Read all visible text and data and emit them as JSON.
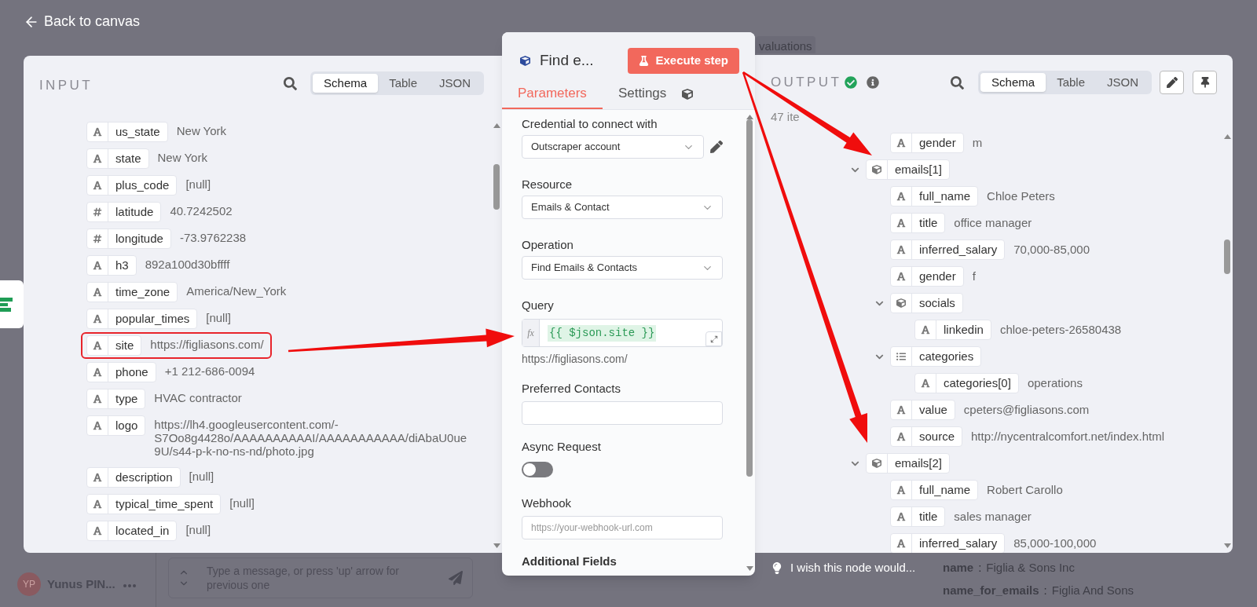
{
  "background": {
    "back_link": "Back to canvas",
    "tab_label": "valuations",
    "user": {
      "initials": "YP",
      "name": "Yunus PIN..."
    },
    "chat": {
      "placeholder": "Type a message, or press 'up' arrow for previous one"
    },
    "details": [
      {
        "key": "name",
        "separator": ":",
        "value": "Figlia & Sons Inc"
      },
      {
        "key": "name_for_emails",
        "separator": ":",
        "value": "Figlia And Sons"
      }
    ]
  },
  "input": {
    "title": "INPUT",
    "views": [
      {
        "label": "Schema",
        "selected": true
      },
      {
        "label": "Table",
        "selected": false
      },
      {
        "label": "JSON",
        "selected": false
      }
    ],
    "fields": [
      {
        "kind": "string",
        "key": "us_state",
        "value": "New York",
        "highlighted": false
      },
      {
        "kind": "string",
        "key": "state",
        "value": "New York",
        "highlighted": false
      },
      {
        "kind": "string",
        "key": "plus_code",
        "value": "[null]",
        "highlighted": false
      },
      {
        "kind": "number",
        "key": "latitude",
        "value": "40.7242502",
        "highlighted": false
      },
      {
        "kind": "number",
        "key": "longitude",
        "value": "-73.9762238",
        "highlighted": false
      },
      {
        "kind": "string",
        "key": "h3",
        "value": "892a100d30bffff",
        "highlighted": false
      },
      {
        "kind": "string",
        "key": "time_zone",
        "value": "America/New_York",
        "highlighted": false
      },
      {
        "kind": "string",
        "key": "popular_times",
        "value": "[null]",
        "highlighted": false
      },
      {
        "kind": "string",
        "key": "site",
        "value": "https://figliasons.com/",
        "highlighted": true
      },
      {
        "kind": "string",
        "key": "phone",
        "value": "+1 212-686-0094",
        "highlighted": false
      },
      {
        "kind": "string",
        "key": "type",
        "value": "HVAC contractor",
        "highlighted": false
      },
      {
        "kind": "string",
        "key": "logo",
        "value": "https://lh4.googleusercontent.com/-S7Oo8g4428o/AAAAAAAAAAI/AAAAAAAAAAA/diAbaU0ue9U/s44-p-k-no-ns-nd/photo.jpg",
        "highlighted": false
      },
      {
        "kind": "string",
        "key": "description",
        "value": "[null]",
        "highlighted": false
      },
      {
        "kind": "string",
        "key": "typical_time_spent",
        "value": "[null]",
        "highlighted": false
      },
      {
        "kind": "string",
        "key": "located_in",
        "value": "[null]",
        "highlighted": false
      }
    ]
  },
  "node": {
    "title": "Find e...",
    "execute_label": "Execute step",
    "tabs": [
      {
        "label": "Parameters",
        "selected": true
      },
      {
        "label": "Settings",
        "selected": false
      }
    ],
    "params": [
      {
        "kind": "select",
        "label": "Credential to connect with",
        "value": "Outscraper account",
        "editable": true
      },
      {
        "kind": "select",
        "label": "Resource",
        "value": "Emails & Contact",
        "editable": false
      },
      {
        "kind": "select",
        "label": "Operation",
        "value": "Find Emails & Contacts",
        "editable": false
      },
      {
        "kind": "expression",
        "label": "Query",
        "prefix": "fx",
        "value": "{{ $json.site }}",
        "hint": "https://figliasons.com/"
      },
      {
        "kind": "text",
        "label": "Preferred Contacts"
      },
      {
        "kind": "toggle",
        "label": "Async Request",
        "on": false
      },
      {
        "kind": "text",
        "label": "Webhook",
        "placeholder": "https://your-webhook-url.com"
      },
      {
        "kind": "section",
        "label": "Additional Fields"
      }
    ]
  },
  "output": {
    "title": "OUTPUT",
    "success": true,
    "views": [
      {
        "label": "Schema",
        "selected": true
      },
      {
        "label": "Table",
        "selected": false
      },
      {
        "label": "JSON",
        "selected": false
      }
    ],
    "count": "47 ite",
    "trailing_children": [
      {
        "kind": "string",
        "key": "gender",
        "value": "m"
      }
    ],
    "tree": [
      {
        "kind": "object",
        "key": "emails[1]",
        "expanded": true,
        "children": [
          {
            "kind": "string",
            "key": "full_name",
            "value": "Chloe Peters"
          },
          {
            "kind": "string",
            "key": "title",
            "value": "office manager"
          },
          {
            "kind": "string",
            "key": "inferred_salary",
            "value": "70,000-85,000"
          },
          {
            "kind": "string",
            "key": "gender",
            "value": "f"
          },
          {
            "kind": "object",
            "key": "socials",
            "expanded": true,
            "children": [
              {
                "kind": "string",
                "key": "linkedin",
                "value": "chloe-peters-26580438"
              }
            ]
          },
          {
            "kind": "array",
            "key": "categories",
            "expanded": true,
            "children": [
              {
                "kind": "string",
                "key": "categories[0]",
                "value": "operations"
              }
            ]
          },
          {
            "kind": "string",
            "key": "value",
            "value": "cpeters@figliasons.com"
          },
          {
            "kind": "string",
            "key": "source",
            "value": "http://nycentralcomfort.net/index.html"
          }
        ]
      },
      {
        "kind": "object",
        "key": "emails[2]",
        "expanded": true,
        "children": [
          {
            "kind": "string",
            "key": "full_name",
            "value": "Robert Carollo"
          },
          {
            "kind": "string",
            "key": "title",
            "value": "sales manager"
          },
          {
            "kind": "string",
            "key": "inferred_salary",
            "value": "85,000-100,000"
          }
        ]
      }
    ],
    "feedback": "I wish this node would..."
  }
}
